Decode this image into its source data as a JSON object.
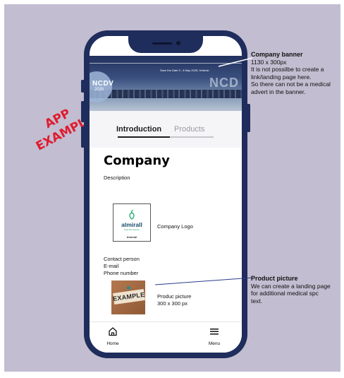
{
  "stamp": {
    "line1": "APP",
    "line2": "EXAMPLE"
  },
  "banner": {
    "logo_text": "NCDV",
    "logo_sub": "2025",
    "save_date": "Save the Date  5 - 8 May 2025, Helsinki",
    "big_text": "NCD"
  },
  "tabs": {
    "introduction": "Introduction",
    "products": "Products",
    "active": "introduction"
  },
  "content": {
    "title": "Company",
    "description": "Description",
    "logo": {
      "wordmark": "almirall",
      "tagline": "Feel the science",
      "bottom": "Almirall"
    },
    "logo_label": "Company Logo",
    "contact": [
      "Contact person",
      "E-mail",
      "Phone number"
    ],
    "product_image_word": "EXAMPLE",
    "product_label_line1": "Produc picture",
    "product_label_line2": "300 x 300 px"
  },
  "nav": {
    "home": "Home",
    "menu": "Menu"
  },
  "annotations": {
    "banner": {
      "title": "Company banner",
      "lines": [
        "1130 x 300px",
        "It is not possilbe to create a",
        "link/landing page here.",
        "So there can not be a medical",
        "advert in the banner."
      ]
    },
    "product": {
      "title": "Product picture",
      "lines": [
        "We can create a landing page",
        "for additional medical spc",
        "text."
      ]
    }
  },
  "colors": {
    "background": "#c2bdd0",
    "phone_frame": "#1f2d5c",
    "stamp_red": "#e11b2f",
    "tab_active": "#1d1d1f",
    "tab_inactive": "#9a9aa0"
  }
}
